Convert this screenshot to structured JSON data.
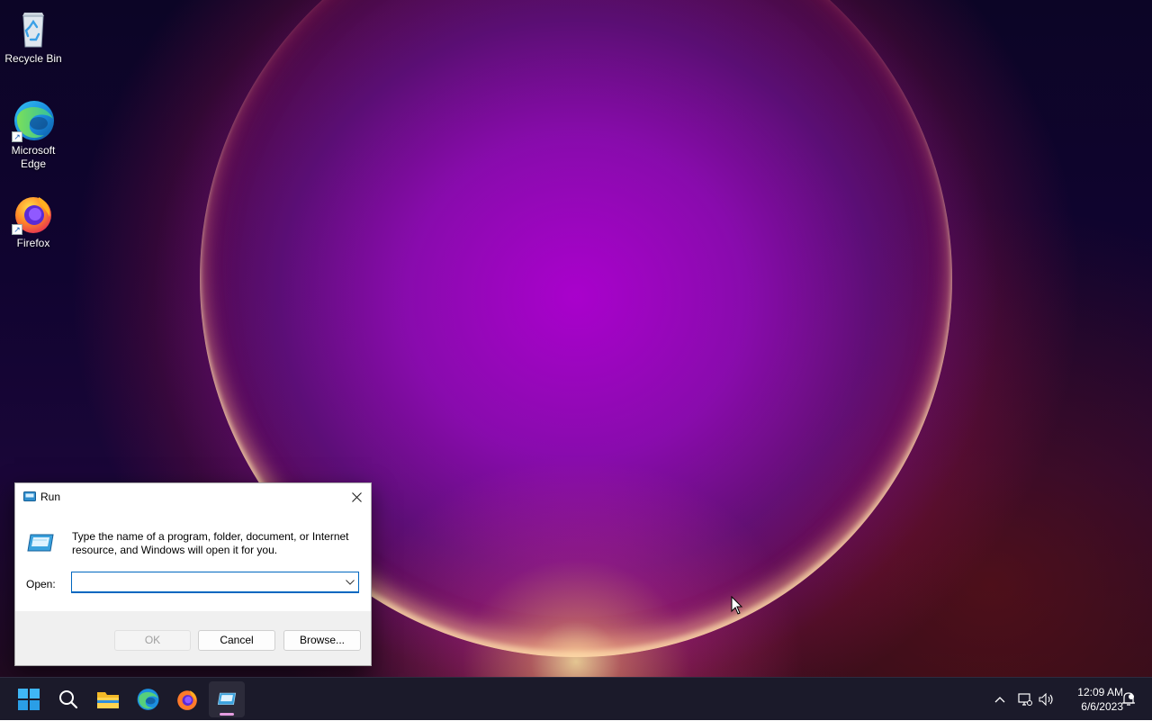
{
  "desktop": {
    "icons": [
      {
        "label": "Recycle Bin",
        "icon": "recycle-bin-icon"
      },
      {
        "label": "Microsoft Edge",
        "icon": "edge-icon"
      },
      {
        "label": "Firefox",
        "icon": "firefox-icon"
      }
    ]
  },
  "run_dialog": {
    "title": "Run",
    "description": "Type the name of a program, folder, document, or Internet resource, and Windows will open it for you.",
    "open_label": "Open:",
    "open_value": "",
    "ok_label": "OK",
    "cancel_label": "Cancel",
    "browse_label": "Browse..."
  },
  "taskbar": {
    "items": [
      "start-icon",
      "search-icon",
      "file-explorer-icon",
      "edge-icon",
      "firefox-icon",
      "run-icon"
    ],
    "time": "12:09 AM",
    "date": "6/6/2023"
  },
  "colors": {
    "accent": "#0067c0",
    "taskbar": "#1b1a2a"
  }
}
